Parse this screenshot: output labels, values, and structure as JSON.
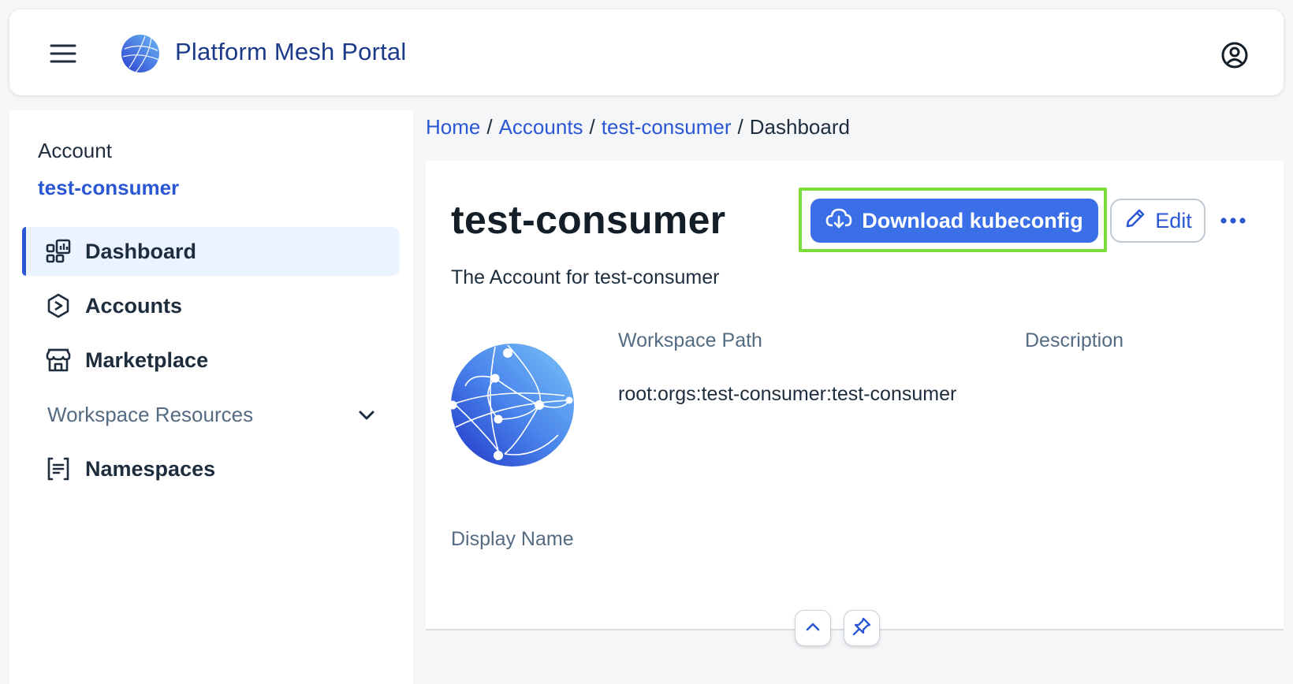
{
  "shell": {
    "title": "Platform Mesh Portal",
    "menu_icon": "hamburger-menu-icon",
    "logo": "platform-mesh-globe-logo",
    "user_icon": "user-account-icon"
  },
  "sidenav": {
    "header_label": "Account",
    "header_value": "test-consumer",
    "items": [
      {
        "label": "Dashboard",
        "icon": "dashboard-icon",
        "active": true
      },
      {
        "label": "Accounts",
        "icon": "accounts-icon"
      },
      {
        "label": "Marketplace",
        "icon": "marketplace-icon"
      },
      {
        "label": "Workspace Resources",
        "icon": "chevron-down-icon",
        "group": true
      },
      {
        "label": "Namespaces",
        "icon": "namespaces-icon"
      }
    ]
  },
  "breadcrumb": {
    "items": [
      "Home",
      "Accounts",
      "test-consumer"
    ],
    "separator": "/",
    "current": "Dashboard"
  },
  "header": {
    "title": "test-consumer",
    "subtitle": "The Account for test-consumer",
    "download_label": "Download kubeconfig",
    "edit_label": "Edit"
  },
  "details": {
    "workspace_path_label": "Workspace Path",
    "workspace_path_value": "root:orgs:test-consumer:test-consumer",
    "description_label": "Description",
    "display_name_label": "Display Name"
  },
  "colors": {
    "accent": "#2b57d4",
    "primary_button": "#3b6fe8",
    "highlight": "#7bdc3a"
  }
}
